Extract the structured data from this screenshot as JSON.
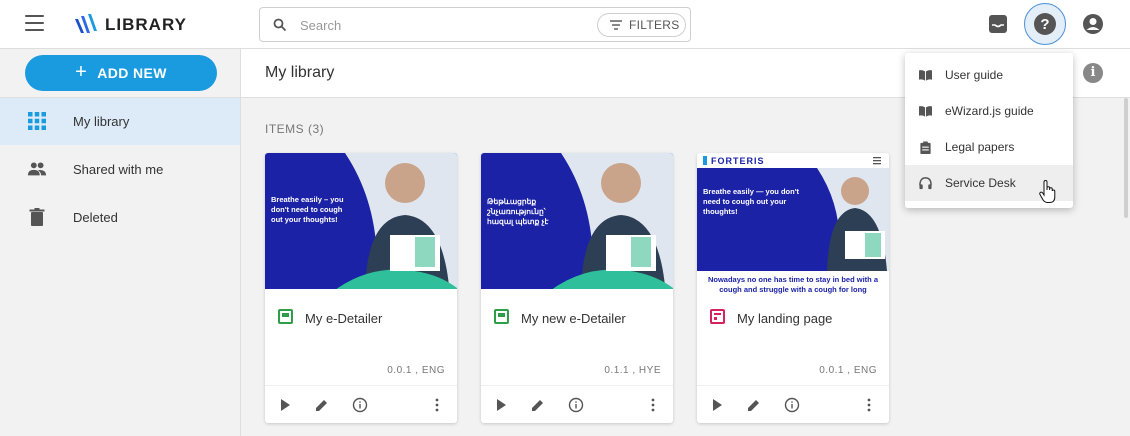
{
  "app": {
    "brand": "Library"
  },
  "search": {
    "placeholder": "Search",
    "filters_label": "FILTERS"
  },
  "add_new_label": "ADD NEW",
  "page_title": "My library",
  "sidebar": {
    "items": [
      {
        "label": "My library",
        "icon": "grid-icon",
        "active": true
      },
      {
        "label": "Shared with me",
        "icon": "people-icon",
        "active": false
      },
      {
        "label": "Deleted",
        "icon": "trash-icon",
        "active": false
      }
    ]
  },
  "items_label": "ITEMS (3)",
  "cards": [
    {
      "title": "My e-Detailer",
      "version": "0.0.1 , ENG",
      "type": "e-detailer",
      "thumb_text": "Breathe easily – you don't need to cough out your thoughts!"
    },
    {
      "title": "My new e-Detailer",
      "version": "0.1.1 , HYE",
      "type": "e-detailer",
      "thumb_text": "Թեթևացրեք շնչառությունը՝ հազալ պետք չէ"
    },
    {
      "title": "My landing page",
      "version": "0.0.1 , ENG",
      "type": "landing-page",
      "thumb_brand": "FORTERIS",
      "thumb_text": "Breathe easily — you don't need to cough out your thoughts!",
      "thumb_footer": "Nowadays no one has time to stay in bed with a cough and struggle with a cough for long"
    }
  ],
  "help_menu": {
    "items": [
      {
        "label": "User guide",
        "icon": "book-icon"
      },
      {
        "label": "eWizard.js guide",
        "icon": "book-icon"
      },
      {
        "label": "Legal papers",
        "icon": "clipboard-icon"
      },
      {
        "label": "Service Desk",
        "icon": "headset-icon"
      }
    ]
  },
  "colors": {
    "accent": "#1a9be0",
    "thumb_blue": "#1b22a6",
    "active_bg": "#dcebf7"
  }
}
